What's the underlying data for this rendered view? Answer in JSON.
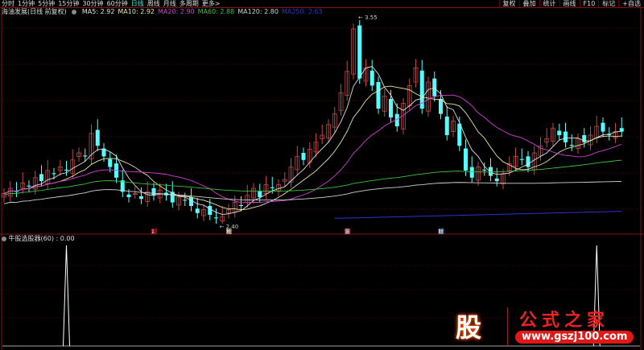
{
  "toolbar": {
    "periods": [
      "分时",
      "1分钟",
      "5分钟",
      "15分钟",
      "30分钟",
      "60分钟",
      "日线",
      "周线",
      "月线",
      "多周期",
      "更多>"
    ],
    "active_index": 6,
    "right_buttons": [
      "复权",
      "叠加",
      "统计",
      "画线",
      "F10",
      "标记",
      "+自选"
    ]
  },
  "info": {
    "title": "海油发展(日线 前复权)",
    "ma": [
      {
        "label": "MA5: 2.92",
        "color": "#e0e0e0"
      },
      {
        "label": "MA10: 2.92",
        "color": "#e8e8a0"
      },
      {
        "label": "MA20: 2.90",
        "color": "#d040d0"
      },
      {
        "label": "MA60: 2.88",
        "color": "#40c040"
      },
      {
        "label": "MA120: 2.80",
        "color": "#d0d0d0"
      },
      {
        "label": "MA250: 2.63",
        "color": "#3030d0"
      }
    ]
  },
  "indicator": {
    "title": "牛股选股器(60) : 0.00"
  },
  "logo": {
    "glyph": "股",
    "name": "公式之家",
    "url": "www.gszj100.com"
  },
  "chart_data": {
    "type": "candlestick",
    "ylim": [
      2.4,
      3.55
    ],
    "annotations": [
      {
        "label": "3.55",
        "type": "high"
      },
      {
        "label": "2.40",
        "type": "low"
      }
    ],
    "close": [
      2.57,
      2.6,
      2.58,
      2.63,
      2.61,
      2.66,
      2.64,
      2.7,
      2.68,
      2.72,
      2.7,
      2.76,
      2.8,
      2.78,
      2.91,
      2.84,
      2.78,
      2.72,
      2.66,
      2.58,
      2.55,
      2.57,
      2.54,
      2.58,
      2.56,
      2.59,
      2.56,
      2.52,
      2.55,
      2.53,
      2.5,
      2.46,
      2.48,
      2.45,
      2.43,
      2.44,
      2.48,
      2.52,
      2.5,
      2.56,
      2.6,
      2.55,
      2.62,
      2.6,
      2.62,
      2.65,
      2.72,
      2.78,
      2.76,
      2.82,
      2.86,
      2.9,
      2.96,
      3.02,
      3.14,
      3.26,
      3.5,
      3.22,
      3.28,
      3.18,
      3.05,
      3.12,
      3.0,
      2.95,
      3.08,
      3.18,
      3.28,
      3.05,
      3.2,
      3.12,
      3.02,
      2.9,
      2.98,
      2.84,
      2.7,
      2.66,
      2.72,
      2.7,
      2.67,
      2.64,
      2.68,
      2.74,
      2.78,
      2.76,
      2.72,
      2.8,
      2.84,
      2.88,
      2.94,
      2.9,
      2.86,
      2.84,
      2.88,
      2.86,
      2.9,
      2.95,
      2.92,
      2.9,
      2.92,
      2.92
    ],
    "ma_periods": [
      5,
      10,
      20,
      60,
      120
    ],
    "markers": [
      {
        "index": 24,
        "label": "1",
        "color": "#d02020"
      },
      {
        "index": 36,
        "label": "税",
        "color": "#d0a060"
      },
      {
        "index": 55,
        "label": "涨",
        "color": "#d06070"
      },
      {
        "index": 70,
        "label": "财",
        "color": "#70a0d0"
      }
    ],
    "indicator_spikes": [
      10,
      95
    ]
  }
}
